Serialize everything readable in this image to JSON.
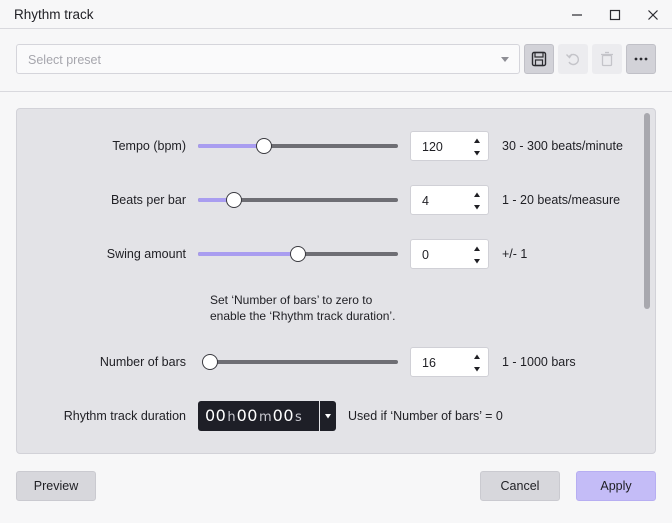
{
  "window": {
    "title": "Rhythm track"
  },
  "preset": {
    "placeholder": "Select preset"
  },
  "rows": {
    "tempo": {
      "label": "Tempo (bpm)",
      "value": "120",
      "range": "30 - 300 beats/minute",
      "slider_fraction": 0.33
    },
    "beats": {
      "label": "Beats per bar",
      "value": "4",
      "range": "1 - 20 beats/measure",
      "slider_fraction": 0.18
    },
    "swing": {
      "label": "Swing amount",
      "value": "0",
      "range": "+/- 1",
      "slider_fraction": 0.5
    },
    "bars": {
      "label": "Number of bars",
      "value": "16",
      "range": "1 - 1000 bars",
      "slider_fraction": 0.02
    }
  },
  "note": {
    "line1": "Set ‘Number of bars’ to zero to",
    "line2": "enable the ‘Rhythm track duration’."
  },
  "duration": {
    "label": "Rhythm track duration",
    "hours": "00",
    "h_unit": "h",
    "minutes": "00",
    "m_unit": "m",
    "seconds": "00",
    "s_unit": "s",
    "hint": "Used if ‘Number of bars’ = 0"
  },
  "buttons": {
    "preview": "Preview",
    "cancel": "Cancel",
    "apply": "Apply"
  },
  "colors": {
    "accent": "#a99df0",
    "apply_bg": "#c4bcf7",
    "panel_bg": "#e3e3e7",
    "duration_bg": "#1e1f27"
  }
}
